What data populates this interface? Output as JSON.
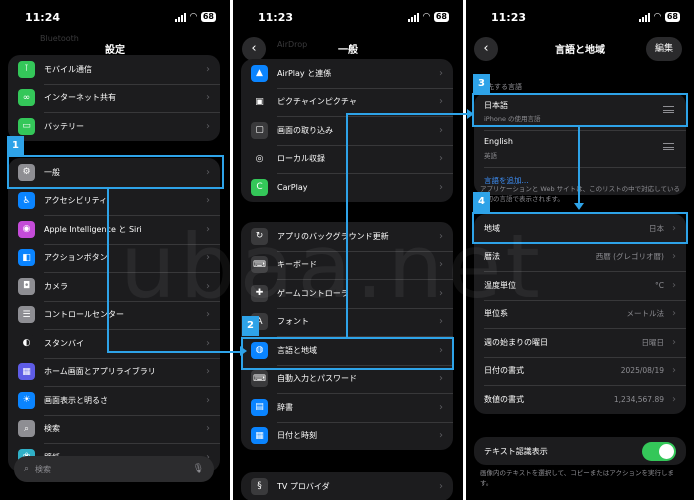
{
  "panel1": {
    "status": {
      "time": "11:24",
      "battery": "68"
    },
    "title": "設定",
    "top_faded_label": "Bluetooth",
    "group1": [
      {
        "label": "モバイル通信",
        "icon": "antenna-icon",
        "color": "#34c759"
      },
      {
        "label": "インターネット共有",
        "icon": "link-icon",
        "color": "#34c759"
      },
      {
        "label": "バッテリー",
        "icon": "battery-icon",
        "color": "#34c759"
      }
    ],
    "group2": [
      {
        "label": "一般",
        "icon": "gear-icon",
        "color": "#8e8e93"
      },
      {
        "label": "アクセシビリティ",
        "icon": "accessibility-icon",
        "color": "#0a84ff"
      },
      {
        "label": "Apple Intelligence と Siri",
        "icon": "siri-icon",
        "color": "#c44bd8"
      },
      {
        "label": "アクションボタン",
        "icon": "action-button-icon",
        "color": "#0a84ff"
      },
      {
        "label": "カメラ",
        "icon": "camera-icon",
        "color": "#8e8e93"
      },
      {
        "label": "コントロールセンター",
        "icon": "toggles-icon",
        "color": "#8e8e93"
      },
      {
        "label": "スタンバイ",
        "icon": "standby-icon",
        "color": "#1c1c1e"
      },
      {
        "label": "ホーム画面とアプリライブラリ",
        "icon": "home-screen-icon",
        "color": "#5e5ce6"
      },
      {
        "label": "画面表示と明るさ",
        "icon": "brightness-icon",
        "color": "#0a84ff"
      },
      {
        "label": "検索",
        "icon": "search-icon",
        "color": "#8e8e93"
      },
      {
        "label": "壁紙",
        "icon": "wallpaper-icon",
        "color": "#30b0c7"
      }
    ],
    "search_placeholder": "検索",
    "badge": "1"
  },
  "panel2": {
    "status": {
      "time": "11:23",
      "battery": "68"
    },
    "title": "一般",
    "top_faded_label": "AirDrop",
    "group1": [
      {
        "label": "AirPlay と連係",
        "icon": "airplay-icon",
        "color": "#0a84ff"
      },
      {
        "label": "ピクチャインピクチャ",
        "icon": "pip-icon",
        "color": "#1c1c1e"
      },
      {
        "label": "画面の取り込み",
        "icon": "screen-capture-icon",
        "color": "#3a3a3c"
      },
      {
        "label": "ローカル収録",
        "icon": "local-capture-icon",
        "color": "#1c1c1e"
      },
      {
        "label": "CarPlay",
        "icon": "carplay-icon",
        "color": "#34c759"
      }
    ],
    "group2": [
      {
        "label": "アプリのバックグラウンド更新",
        "icon": "background-refresh-icon",
        "color": "#3a3a3c"
      },
      {
        "label": "キーボード",
        "icon": "keyboard-icon",
        "color": "#3a3a3c"
      },
      {
        "label": "ゲームコントローラ",
        "icon": "gamepad-icon",
        "color": "#3a3a3c"
      },
      {
        "label": "フォント",
        "icon": "font-icon",
        "color": "#3a3a3c"
      },
      {
        "label": "言語と地域",
        "icon": "globe-icon",
        "color": "#0a84ff"
      },
      {
        "label": "自動入力とパスワード",
        "icon": "keyboard-fill-icon",
        "color": "#3a3a3c"
      },
      {
        "label": "辞書",
        "icon": "book-icon",
        "color": "#0a84ff"
      },
      {
        "label": "日付と時刻",
        "icon": "calendar-icon",
        "color": "#0a84ff"
      }
    ],
    "group3": [
      {
        "label": "TV プロバイダ",
        "icon": "tv-provider-icon",
        "color": "#3a3a3c"
      }
    ],
    "badge": "2"
  },
  "panel3": {
    "status": {
      "time": "11:23",
      "battery": "68"
    },
    "title": "言語と地域",
    "edit_label": "編集",
    "preferred_header": "優先する言語",
    "languages": [
      {
        "name": "日本語",
        "sub": "iPhone の使用言語"
      },
      {
        "name": "English",
        "sub": "英語"
      }
    ],
    "add_language": "言語を追加...",
    "note1": "アプリケーションと Web サイトは、このリストの中で対応している最初の言語で表示されます。",
    "region_rows": [
      {
        "label": "地域",
        "value": "日本"
      },
      {
        "label": "暦法",
        "value": "西暦 (グレゴリオ暦)"
      },
      {
        "label": "温度単位",
        "value": "°C"
      },
      {
        "label": "単位系",
        "value": "メートル法"
      },
      {
        "label": "週の始まりの曜日",
        "value": "日曜日"
      },
      {
        "label": "日付の書式",
        "value": "2025/08/19"
      },
      {
        "label": "数値の書式",
        "value": "1,234,567.89"
      }
    ],
    "live_text_label": "テキスト認識表示",
    "live_text_note": "画像内のテキストを選択して、コピーまたはアクションを実行します。",
    "badge3": "3",
    "badge4": "4"
  },
  "watermark": "ubaa.net"
}
